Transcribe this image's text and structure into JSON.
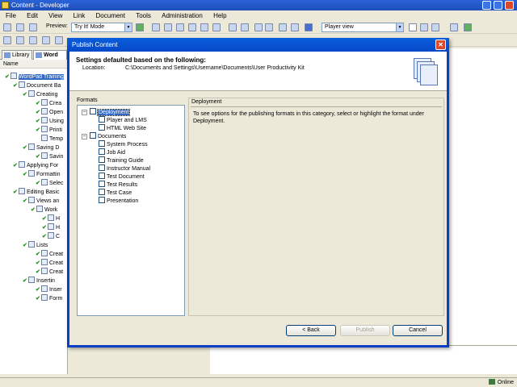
{
  "app": {
    "title": "Content - Developer",
    "menu": [
      "File",
      "Edit",
      "View",
      "Link",
      "Document",
      "Tools",
      "Administration",
      "Help"
    ],
    "preview_label": "Preview:",
    "preview_mode": "Try It! Mode",
    "view_mode": "Player view"
  },
  "left_pane": {
    "tabs": [
      "Library",
      "Word"
    ],
    "column_header": "Name",
    "tree": [
      {
        "label": "WordPad Training",
        "selected": true
      },
      {
        "label": "Document Ba"
      },
      {
        "label": "Creating"
      },
      {
        "label": "Crea"
      },
      {
        "label": "Open"
      },
      {
        "label": "Using"
      },
      {
        "label": "Printi"
      },
      {
        "label": "Temp"
      },
      {
        "label": "Saving D"
      },
      {
        "label": "Savin"
      },
      {
        "label": "Applying For"
      },
      {
        "label": "Formattin"
      },
      {
        "label": "Selec"
      },
      {
        "label": "Editing Basic"
      },
      {
        "label": "Views an"
      },
      {
        "label": "Work"
      },
      {
        "label": "H"
      },
      {
        "label": "H"
      },
      {
        "label": "C"
      },
      {
        "label": "Lists"
      },
      {
        "label": "Creat"
      },
      {
        "label": "Creat"
      },
      {
        "label": "Creat"
      },
      {
        "label": "Insertin"
      },
      {
        "label": "Inser"
      },
      {
        "label": "Form"
      }
    ]
  },
  "dialog": {
    "title": "Publish Content",
    "heading": "Settings defaulted based on the following:",
    "location_label": "Location:",
    "location_value": "C:\\Documents and Settings\\Username\\Documents\\User Productivity Kit",
    "formats_label": "Formats",
    "formats_tree": [
      {
        "label": "Deployment",
        "selected": true
      },
      {
        "label": "Player and LMS"
      },
      {
        "label": "HTML Web Site"
      },
      {
        "label": "Documents"
      },
      {
        "label": "System Process"
      },
      {
        "label": "Job Aid"
      },
      {
        "label": "Training Guide"
      },
      {
        "label": "Instructor Manual"
      },
      {
        "label": "Test Document"
      },
      {
        "label": "Test Results"
      },
      {
        "label": "Test Case"
      },
      {
        "label": "Presentation"
      }
    ],
    "panel_title": "Deployment",
    "panel_description": "To see options for the publishing formats in this category, select or highlight the format under Deployment.",
    "buttons": {
      "back": "< Back",
      "publish": "Publish",
      "cancel": "Cancel"
    }
  },
  "status": {
    "online": "Online"
  }
}
